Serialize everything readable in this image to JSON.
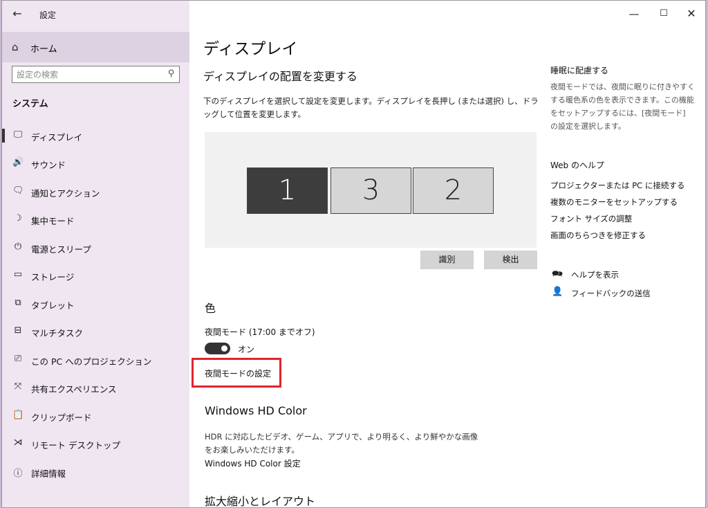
{
  "app_title": "設定",
  "window_controls": {
    "minimize": "—",
    "maximize": "☐",
    "close": "✕"
  },
  "sidebar": {
    "home_label": "ホーム",
    "search_placeholder": "設定の検索",
    "section_title": "システム",
    "items": [
      {
        "label": "ディスプレイ",
        "icon": "monitor-icon",
        "glyph": "🖵",
        "active": true
      },
      {
        "label": "サウンド",
        "icon": "speaker-icon",
        "glyph": "🔊"
      },
      {
        "label": "通知とアクション",
        "icon": "notification-icon",
        "glyph": "🗨"
      },
      {
        "label": "集中モード",
        "icon": "moon-icon",
        "glyph": "☽"
      },
      {
        "label": "電源とスリープ",
        "icon": "power-icon",
        "glyph": "⏻"
      },
      {
        "label": "ストレージ",
        "icon": "storage-icon",
        "glyph": "▭"
      },
      {
        "label": "タブレット",
        "icon": "tablet-icon",
        "glyph": "⧉"
      },
      {
        "label": "マルチタスク",
        "icon": "multitask-icon",
        "glyph": "⊟"
      },
      {
        "label": "この PC へのプロジェクション",
        "icon": "projection-icon",
        "glyph": "⎚"
      },
      {
        "label": "共有エクスペリエンス",
        "icon": "share-icon",
        "glyph": "⤧"
      },
      {
        "label": "クリップボード",
        "icon": "clipboard-icon",
        "glyph": "📋"
      },
      {
        "label": "リモート デスクトップ",
        "icon": "remote-icon",
        "glyph": "⋊"
      },
      {
        "label": "詳細情報",
        "icon": "info-icon",
        "glyph": "ⓘ"
      }
    ]
  },
  "main": {
    "title": "ディスプレイ",
    "arrange_title": "ディスプレイの配置を変更する",
    "arrange_desc": "下のディスプレイを選択して設定を変更します。ディスプレイを長押し (または選択) し、ドラッグして位置を変更します。",
    "monitors": [
      "1",
      "3",
      "2"
    ],
    "identify_button": "識別",
    "detect_button": "検出",
    "color_title": "色",
    "night_light_label": "夜間モード (17:00 までオフ)",
    "toggle_state": "オン",
    "night_light_settings": "夜間モードの設定",
    "hdr_title": "Windows HD Color",
    "hdr_desc": "HDR に対応したビデオ、ゲーム、アプリで、より明るく、より鮮やかな画像をお楽しみいただけます。",
    "hdr_settings": "Windows HD Color 設定",
    "scale_title": "拡大縮小とレイアウト"
  },
  "right": {
    "sleep_title": "睡眠に配慮する",
    "sleep_desc": "夜間モードでは、夜間に眠りに付きやすくする暖色系の色を表示できます。この機能をセットアップするには、[夜間モード] の設定を選択します。",
    "web_help_title": "Web のヘルプ",
    "links": [
      "プロジェクターまたは PC に接続する",
      "複数のモニターをセットアップする",
      "フォント サイズの調整",
      "画面のちらつきを修正する"
    ],
    "get_help": "ヘルプを表示",
    "feedback": "フィードバックの送信"
  },
  "colors": {
    "highlight": "#e0232e",
    "sidebar_bg": "#efe6f2",
    "active_monitor": "#3d3d3d"
  }
}
